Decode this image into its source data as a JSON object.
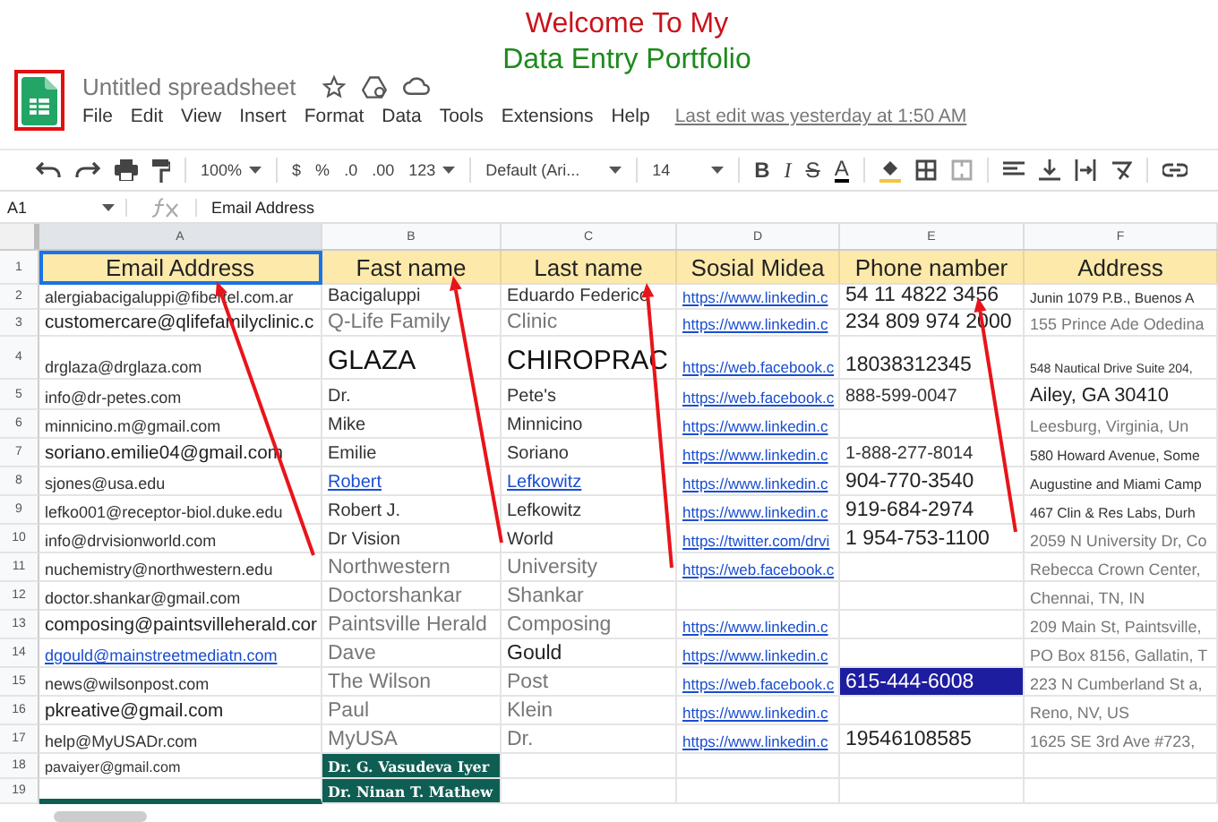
{
  "banner": {
    "line_1": "Welcome To My",
    "line_2": "Data Entry Portfolio"
  },
  "document": {
    "title": "Untitled spreadsheet",
    "menu": [
      "File",
      "Edit",
      "View",
      "Insert",
      "Format",
      "Data",
      "Tools",
      "Extensions",
      "Help"
    ],
    "last_edit": "Last edit was yesterday at 1:50 AM"
  },
  "toolbar": {
    "zoom": "100%",
    "currency": "$",
    "percent": "%",
    "decrease_decimals": ".0",
    "increase_decimals": ".00",
    "number_format": "123",
    "font": "Default (Ari...",
    "font_size": "14",
    "bold": "B",
    "italic": "I",
    "strikethrough": "S",
    "text_color": "A"
  },
  "formula_bar": {
    "cell": "A1",
    "content": "Email Address"
  },
  "table": {
    "columns": [
      "A",
      "B",
      "C",
      "D",
      "E",
      "F"
    ],
    "header_row": {
      "number": "1",
      "cells": [
        {
          "text": "Email Address",
          "selected": true
        },
        {
          "text": "Fast name",
          "selected": false
        },
        {
          "text": "Last name",
          "selected": false
        },
        {
          "text": "Sosial Midea",
          "selected": false
        },
        {
          "text": "Phone namber",
          "selected": false
        },
        {
          "text": "Address",
          "selected": false
        }
      ]
    },
    "rows": [
      {
        "number": "2",
        "cells": [
          {
            "kind": "small",
            "text": "alergiabacigaluppi@fibertel.com.ar"
          },
          {
            "kind": "small",
            "text": "Bacigaluppi"
          },
          {
            "kind": "small",
            "text": "Eduardo Federico"
          },
          {
            "kind": "link",
            "text": "https://www.linkedin.c"
          },
          {
            "kind": "text",
            "text": "54 11 4822 3456"
          },
          {
            "kind": "small",
            "text": "Junin 1079 P.B., Buenos A"
          }
        ]
      },
      {
        "number": "3",
        "cells": [
          {
            "kind": "text",
            "text": "customercare@qlifefamilyclinic.c"
          },
          {
            "kind": "muted",
            "text": "Q-Life Family"
          },
          {
            "kind": "muted",
            "text": "Clinic"
          },
          {
            "kind": "link",
            "text": "https://www.linkedin.c"
          },
          {
            "kind": "text",
            "text": "234 809 974 2000"
          },
          {
            "kind": "muted",
            "text": "155 Prince Ade Odedina"
          }
        ]
      },
      {
        "number": "4",
        "cells": [
          {
            "kind": "small",
            "text": "drglaza@drglaza.com"
          },
          {
            "kind": "large",
            "text": "GLAZA"
          },
          {
            "kind": "large",
            "text": "CHIROPRAC"
          },
          {
            "kind": "link",
            "text": "https://web.facebook.c"
          },
          {
            "kind": "text",
            "text": "18038312345"
          },
          {
            "kind": "tiny",
            "text": "548 Nautical Drive Suite 204,"
          }
        ]
      },
      {
        "number": "5",
        "cells": [
          {
            "kind": "small",
            "text": "info@dr-petes.com"
          },
          {
            "kind": "small",
            "text": "Dr."
          },
          {
            "kind": "small",
            "text": "Pete's"
          },
          {
            "kind": "link",
            "text": "https://web.facebook.c"
          },
          {
            "kind": "small",
            "text": "888-599-0047"
          },
          {
            "kind": "big",
            "text": "Ailey, GA 30410"
          }
        ]
      },
      {
        "number": "6",
        "cells": [
          {
            "kind": "small",
            "text": "minnicino.m@gmail.com"
          },
          {
            "kind": "small",
            "text": "Mike"
          },
          {
            "kind": "small",
            "text": "Minnicino"
          },
          {
            "kind": "link",
            "text": "https://www.linkedin.c"
          },
          {
            "kind": "empty"
          },
          {
            "kind": "muted",
            "text": "Leesburg, Virginia, Un"
          }
        ]
      },
      {
        "number": "7",
        "cells": [
          {
            "kind": "text",
            "text": "soriano.emilie04@gmail.com"
          },
          {
            "kind": "small",
            "text": "Emilie"
          },
          {
            "kind": "small",
            "text": "Soriano"
          },
          {
            "kind": "link",
            "text": "https://www.linkedin.c"
          },
          {
            "kind": "small",
            "text": "1-888-277-8014"
          },
          {
            "kind": "small",
            "text": "580 Howard Avenue, Some"
          }
        ]
      },
      {
        "number": "8",
        "cells": [
          {
            "kind": "small",
            "text": "sjones@usa.edu"
          },
          {
            "kind": "link",
            "text": "Robert"
          },
          {
            "kind": "link",
            "text": "Lefkowitz"
          },
          {
            "kind": "link",
            "text": "https://www.linkedin.c"
          },
          {
            "kind": "text",
            "text": "904-770-3540"
          },
          {
            "kind": "small",
            "text": "Augustine and Miami Camp"
          }
        ]
      },
      {
        "number": "9",
        "cells": [
          {
            "kind": "small",
            "text": "lefko001@receptor-biol.duke.edu"
          },
          {
            "kind": "small",
            "text": "Robert J."
          },
          {
            "kind": "small",
            "text": "Lefkowitz"
          },
          {
            "kind": "link",
            "text": "https://www.linkedin.c"
          },
          {
            "kind": "text",
            "text": "919-684-2974"
          },
          {
            "kind": "small",
            "text": "467 Clin & Res Labs, Durh"
          }
        ]
      },
      {
        "number": "10",
        "cells": [
          {
            "kind": "small",
            "text": "info@drvisionworld.com"
          },
          {
            "kind": "small",
            "text": "Dr Vision"
          },
          {
            "kind": "small",
            "text": "World"
          },
          {
            "kind": "link",
            "text": "https://twitter.com/drvi"
          },
          {
            "kind": "text",
            "text": "1 954-753-1100"
          },
          {
            "kind": "muted",
            "text": "2059 N University Dr, Co"
          }
        ]
      },
      {
        "number": "11",
        "cells": [
          {
            "kind": "small",
            "text": "nuchemistry@northwestern.edu"
          },
          {
            "kind": "muted",
            "text": "Northwestern"
          },
          {
            "kind": "muted",
            "text": "University"
          },
          {
            "kind": "link",
            "text": "https://web.facebook.c"
          },
          {
            "kind": "empty"
          },
          {
            "kind": "muted",
            "text": "Rebecca Crown Center,"
          }
        ]
      },
      {
        "number": "12",
        "cells": [
          {
            "kind": "small",
            "text": "doctor.shankar@gmail.com"
          },
          {
            "kind": "muted",
            "text": "Doctorshankar"
          },
          {
            "kind": "muted",
            "text": "Shankar"
          },
          {
            "kind": "empty"
          },
          {
            "kind": "empty"
          },
          {
            "kind": "muted",
            "text": "Chennai, TN, IN"
          }
        ]
      },
      {
        "number": "13",
        "cells": [
          {
            "kind": "text",
            "text": "composing@paintsvilleherald.cor"
          },
          {
            "kind": "muted",
            "text": "Paintsville Herald"
          },
          {
            "kind": "muted",
            "text": "Composing"
          },
          {
            "kind": "link",
            "text": "https://www.linkedin.c"
          },
          {
            "kind": "empty"
          },
          {
            "kind": "muted",
            "text": "209 Main St, Paintsville,"
          }
        ]
      },
      {
        "number": "14",
        "cells": [
          {
            "kind": "link",
            "text": "dgould@mainstreetmediatn.com"
          },
          {
            "kind": "muted",
            "text": "Dave"
          },
          {
            "kind": "text",
            "text": "Gould"
          },
          {
            "kind": "link",
            "text": "https://www.linkedin.c"
          },
          {
            "kind": "empty"
          },
          {
            "kind": "muted",
            "text": "PO Box 8156, Gallatin, T"
          }
        ]
      },
      {
        "number": "15",
        "cells": [
          {
            "kind": "small",
            "text": "news@wilsonpost.com"
          },
          {
            "kind": "muted",
            "text": "The Wilson"
          },
          {
            "kind": "muted",
            "text": "Post"
          },
          {
            "kind": "link",
            "text": "https://web.facebook.c"
          },
          {
            "kind": "highlight",
            "text": "615-444-6008"
          },
          {
            "kind": "muted",
            "text": "223 N Cumberland St a,"
          }
        ]
      },
      {
        "number": "16",
        "cells": [
          {
            "kind": "text",
            "text": "pkreative@gmail.com"
          },
          {
            "kind": "muted",
            "text": "Paul"
          },
          {
            "kind": "muted",
            "text": "Klein"
          },
          {
            "kind": "link",
            "text": "https://www.linkedin.c"
          },
          {
            "kind": "empty"
          },
          {
            "kind": "muted",
            "text": "Reno, NV, US"
          }
        ]
      },
      {
        "number": "17",
        "cells": [
          {
            "kind": "small",
            "text": "help@MyUSADr.com"
          },
          {
            "kind": "muted",
            "text": "MyUSA"
          },
          {
            "kind": "muted",
            "text": "Dr."
          },
          {
            "kind": "link",
            "text": "https://www.linkedin.c"
          },
          {
            "kind": "text",
            "text": "19546108585"
          },
          {
            "kind": "muted",
            "text": "1625 SE 3rd Ave #723,"
          }
        ]
      },
      {
        "number": "18",
        "cells": [
          {
            "kind": "tiny",
            "text": "pavaiyer@gmail.com"
          },
          {
            "kind": "dark",
            "text": "Dr. G. Vasudeva Iyer"
          },
          {
            "kind": "empty"
          },
          {
            "kind": "empty"
          },
          {
            "kind": "empty"
          },
          {
            "kind": "empty"
          }
        ]
      },
      {
        "number": "19",
        "cells": [
          {
            "kind": "empty"
          },
          {
            "kind": "dark",
            "text": "Dr. Ninan T. Mathew"
          },
          {
            "kind": "empty"
          },
          {
            "kind": "empty"
          },
          {
            "kind": "empty"
          },
          {
            "kind": "empty"
          }
        ]
      }
    ]
  }
}
